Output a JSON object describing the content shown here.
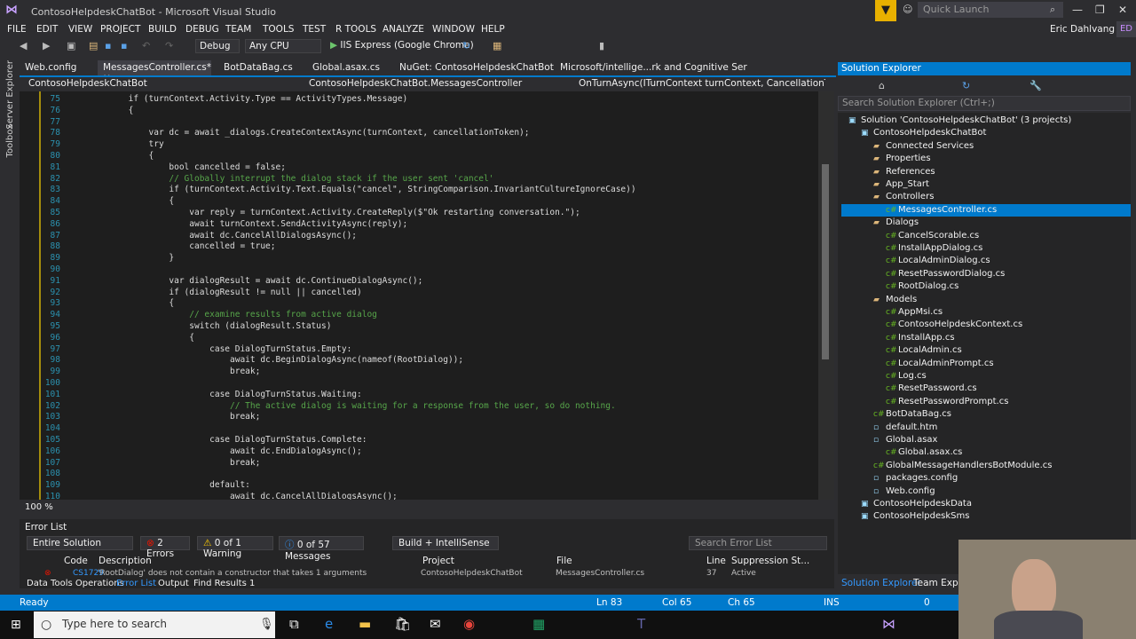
{
  "window": {
    "title": "ContosoHelpdeskChatBot - Microsoft Visual Studio",
    "quick_launch": "Quick Launch",
    "user": "Eric Dahlvang",
    "user_initials": "ED"
  },
  "menu": [
    "FILE",
    "EDIT",
    "VIEW",
    "PROJECT",
    "BUILD",
    "DEBUG",
    "TEAM",
    "TOOLS",
    "TEST",
    "R TOOLS",
    "ANALYZE",
    "WINDOW",
    "HELP"
  ],
  "toolbar": {
    "config": "Debug",
    "platform": "Any CPU",
    "run_target": "IIS Express (Google Chrome)"
  },
  "doc_tabs": [
    "Web.config",
    "MessagesController.cs*",
    "BotDataBag.cs",
    "Global.asax.cs",
    "NuGet: ContosoHelpdeskChatBot",
    "Microsoft/intellige...rk and Cognitive Ser"
  ],
  "nav": {
    "project": "ContosoHelpdeskChatBot",
    "class": "ContosoHelpdeskChatBot.MessagesController",
    "member": "OnTurnAsync(ITurnContext turnContext, CancellationToken canc"
  },
  "left_rail": [
    "Server Explorer",
    "Toolbox"
  ],
  "code_lines": [
    {
      "n": "75",
      "t": "            if (turnContext.Activity.Type == ActivityTypes.Message)"
    },
    {
      "n": "76",
      "t": "            {"
    },
    {
      "n": "77",
      "t": ""
    },
    {
      "n": "78",
      "t": "                var dc = await _dialogs.CreateContextAsync(turnContext, cancellationToken);"
    },
    {
      "n": "79",
      "t": "                try"
    },
    {
      "n": "80",
      "t": "                {"
    },
    {
      "n": "81",
      "t": "                    bool cancelled = false;"
    },
    {
      "n": "82",
      "t": "                    // Globally interrupt the dialog stack if the user sent 'cancel'"
    },
    {
      "n": "83",
      "t": "                    if (turnContext.Activity.Text.Equals(\"cancel\", StringComparison.InvariantCultureIgnoreCase))"
    },
    {
      "n": "84",
      "t": "                    {"
    },
    {
      "n": "85",
      "t": "                        var reply = turnContext.Activity.CreateReply($\"Ok restarting conversation.\");"
    },
    {
      "n": "86",
      "t": "                        await turnContext.SendActivityAsync(reply);"
    },
    {
      "n": "87",
      "t": "                        await dc.CancelAllDialogsAsync();"
    },
    {
      "n": "88",
      "t": "                        cancelled = true;"
    },
    {
      "n": "89",
      "t": "                    }"
    },
    {
      "n": "90",
      "t": ""
    },
    {
      "n": "91",
      "t": "                    var dialogResult = await dc.ContinueDialogAsync();"
    },
    {
      "n": "92",
      "t": "                    if (dialogResult != null || cancelled)"
    },
    {
      "n": "93",
      "t": "                    {"
    },
    {
      "n": "94",
      "t": "                        // examine results from active dialog"
    },
    {
      "n": "95",
      "t": "                        switch (dialogResult.Status)"
    },
    {
      "n": "96",
      "t": "                        {"
    },
    {
      "n": "97",
      "t": "                            case DialogTurnStatus.Empty:"
    },
    {
      "n": "98",
      "t": "                                await dc.BeginDialogAsync(nameof(RootDialog));"
    },
    {
      "n": "99",
      "t": "                                break;"
    },
    {
      "n": "100",
      "t": ""
    },
    {
      "n": "101",
      "t": "                            case DialogTurnStatus.Waiting:"
    },
    {
      "n": "102",
      "t": "                                // The active dialog is waiting for a response from the user, so do nothing."
    },
    {
      "n": "103",
      "t": "                                break;"
    },
    {
      "n": "104",
      "t": ""
    },
    {
      "n": "105",
      "t": "                            case DialogTurnStatus.Complete:"
    },
    {
      "n": "106",
      "t": "                                await dc.EndDialogAsync();"
    },
    {
      "n": "107",
      "t": "                                break;"
    },
    {
      "n": "108",
      "t": ""
    },
    {
      "n": "109",
      "t": "                            default:"
    },
    {
      "n": "110",
      "t": "                                await dc.CancelAllDialogsAsync();"
    }
  ],
  "zoom": "100 %",
  "error_list": {
    "title": "Error List",
    "scope": "Entire Solution",
    "errors": "2 Errors",
    "warnings": "0 of 1 Warning",
    "messages": "0 of 57 Messages",
    "build": "Build + IntelliSense",
    "search": "Search Error List",
    "columns": [
      "Code",
      "Description",
      "Project",
      "File",
      "Line",
      "Suppression St..."
    ],
    "row": {
      "code": "CS1729",
      "description": "'RootDialog' does not contain a constructor that takes 1 arguments",
      "project": "ContosoHelpdeskChatBot",
      "file": "MessagesController.cs",
      "line": "37",
      "suppression": "Active"
    }
  },
  "bottom_tabs": [
    "Data Tools Operations",
    "Error List",
    "Output",
    "Find Results 1"
  ],
  "solution_explorer": {
    "title": "Solution Explorer",
    "search": "Search Solution Explorer (Ctrl+;)",
    "items": [
      {
        "label": "Solution 'ContosoHelpdeskChatBot' (3 projects)",
        "lvl": 0
      },
      {
        "label": "ContosoHelpdeskChatBot",
        "lvl": 1
      },
      {
        "label": "Connected Services",
        "lvl": 2
      },
      {
        "label": "Properties",
        "lvl": 2
      },
      {
        "label": "References",
        "lvl": 2
      },
      {
        "label": "App_Start",
        "lvl": 2
      },
      {
        "label": "Controllers",
        "lvl": 2
      },
      {
        "label": "MessagesController.cs",
        "lvl": 3
      },
      {
        "label": "Dialogs",
        "lvl": 2
      },
      {
        "label": "CancelScorable.cs",
        "lvl": 3
      },
      {
        "label": "InstallAppDialog.cs",
        "lvl": 3
      },
      {
        "label": "LocalAdminDialog.cs",
        "lvl": 3
      },
      {
        "label": "ResetPasswordDialog.cs",
        "lvl": 3
      },
      {
        "label": "RootDialog.cs",
        "lvl": 3
      },
      {
        "label": "Models",
        "lvl": 2
      },
      {
        "label": "AppMsi.cs",
        "lvl": 3
      },
      {
        "label": "ContosoHelpdeskContext.cs",
        "lvl": 3
      },
      {
        "label": "InstallApp.cs",
        "lvl": 3
      },
      {
        "label": "LocalAdmin.cs",
        "lvl": 3
      },
      {
        "label": "LocalAdminPrompt.cs",
        "lvl": 3
      },
      {
        "label": "Log.cs",
        "lvl": 3
      },
      {
        "label": "ResetPassword.cs",
        "lvl": 3
      },
      {
        "label": "ResetPasswordPrompt.cs",
        "lvl": 3
      },
      {
        "label": "BotDataBag.cs",
        "lvl": 2
      },
      {
        "label": "default.htm",
        "lvl": 2
      },
      {
        "label": "Global.asax",
        "lvl": 2
      },
      {
        "label": "Global.asax.cs",
        "lvl": 3
      },
      {
        "label": "GlobalMessageHandlersBotModule.cs",
        "lvl": 2
      },
      {
        "label": "packages.config",
        "lvl": 2
      },
      {
        "label": "Web.config",
        "lvl": 2
      },
      {
        "label": "ContosoHelpdeskData",
        "lvl": 1
      },
      {
        "label": "ContosoHelpdeskSms",
        "lvl": 1
      }
    ],
    "tabs": [
      "Solution Explorer",
      "Team Explor"
    ]
  },
  "status": {
    "state": "Ready",
    "ln": "Ln 83",
    "col": "Col 65",
    "ch": "Ch 65",
    "ins": "INS",
    "arrows": "0"
  },
  "taskbar": {
    "search_placeholder": "Type here to search"
  }
}
